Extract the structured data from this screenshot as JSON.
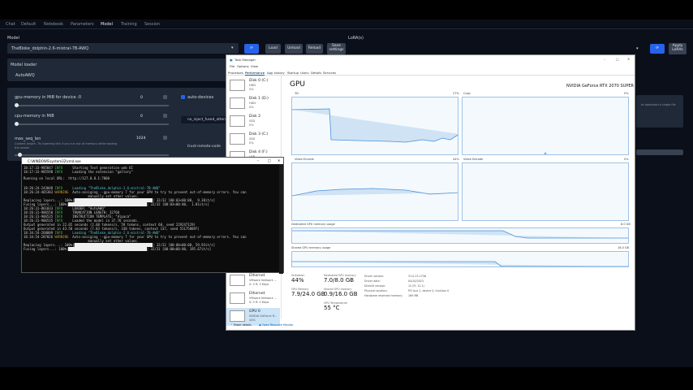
{
  "webui": {
    "tabs": [
      "Chat",
      "Default",
      "Notebook",
      "Parameters",
      "Model",
      "Training",
      "Session"
    ],
    "active_tab": "Model",
    "model_label": "Model",
    "model_value": "TheBloke_dolphin-2.6-mistral-7B-AWQ",
    "buttons": {
      "load": "Load",
      "unload": "Unload",
      "reload": "Reload",
      "save": "Save settings",
      "apply_lora": "Apply LoRAs"
    },
    "lora_label": "LoRA(s)",
    "loader_label": "Model loader",
    "loader_value": "AutoAWQ",
    "gpu_mem_label": "gpu-memory in MiB for device :0",
    "gpu_mem_value": "0",
    "cpu_mem_label": "cpu-memory in MiB",
    "cpu_mem_value": "0",
    "max_seq_label": "max_seq_len",
    "max_seq_value": "1024",
    "max_seq_help": "Context length. Try lowering this if you run out of memory while loading the model.",
    "auto_devices": "auto-devices",
    "no_inject": "no_inject_fused_atten",
    "trust_remote": "trust-remote-code",
    "right_hint": "to download a single file"
  },
  "taskmanager": {
    "title": "Task Manager",
    "menu": [
      "File",
      "Options",
      "View"
    ],
    "tabs": [
      "Processes",
      "Performance",
      "App history",
      "Startup",
      "Users",
      "Details",
      "Services"
    ],
    "active_tab": "Performance",
    "side_items": [
      {
        "name": "Disk 0 (C:)",
        "l1": "HDD",
        "l2": "0%"
      },
      {
        "name": "Disk 1 (D:)",
        "l1": "HDD",
        "l2": "0%"
      },
      {
        "name": "Disk 2",
        "l1": "SSD",
        "l2": "0%"
      },
      {
        "name": "Disk 3 (C:)",
        "l1": "SSD",
        "l2": "0%"
      },
      {
        "name": "Disk 4 (F:)",
        "l1": "USB",
        "l2": "0%"
      },
      {
        "name": "Ethernet",
        "l1": "VMware Network ...",
        "l2": "S: 0 R: 0 Kbps"
      },
      {
        "name": "Ethernet",
        "l1": "VMware Network ...",
        "l2": "S: 0 R: 0 Kbps"
      },
      {
        "name": "GPU 0",
        "l1": "NVIDIA GeForce R...",
        "l2": "44%"
      }
    ],
    "gpu_title": "GPU",
    "gpu_model": "NVIDIA GeForce RTX 2070 SUPER",
    "graphs": {
      "g1": "3D",
      "g2": "Copy",
      "g3": "Video Encode",
      "g4": "Video Decode",
      "pct1": "27%",
      "pct2": "0%",
      "pct3": "44%",
      "pct4": "0%"
    },
    "dedicated_label": "Dedicated GPU memory usage",
    "dedicated_max": "8.0 GB",
    "shared_label": "Shared GPU memory usage",
    "shared_max": "16.0 GB",
    "stats": {
      "util_k": "Utilization",
      "util_v": "44%",
      "ded_k": "Dedicated GPU memory",
      "ded_v": "7.0/8.0 GB",
      "gpum_k": "GPU Memory",
      "gpum_v": "7.9/24.0 GB",
      "sh_k": "Shared GPU memory",
      "sh_v": "0.9/16.0 GB",
      "temp_k": "GPU Temperature",
      "temp_v": "55 °C"
    },
    "details": [
      [
        "Driver version:",
        "31.0.15.2756"
      ],
      [
        "Driver date:",
        "04/10/2023"
      ],
      [
        "DirectX version:",
        "12 (FL 12.1)"
      ],
      [
        "Physical location:",
        "PCI bus 1, device 0, function 0"
      ],
      [
        "Hardware reserved memory:",
        "169 MB"
      ]
    ],
    "fewer_details": "Fewer details",
    "resource_monitor": "Open Resource Monitor"
  },
  "cmd": {
    "title": "C:\\WINDOWS\\system32\\cmd.exe",
    "lines": [
      {
        "t": "18:17:33-985847",
        "l": "INFO",
        "m": "Starting Text generation web UI"
      },
      {
        "t": "18:17:33-985598",
        "l": "INFO",
        "m": "Loading the extension \"gallery\""
      },
      {
        "t": "",
        "l": "",
        "m": "Running on local URL:  http://127.0.0.1:7860"
      },
      {
        "t": "18:26:24-243048",
        "l": "INFO",
        "m": "Loading \"TheBloke_dolphin-2.6-mistral-7B-AWQ\""
      },
      {
        "t": "18:26:24-465383",
        "l": "WARNING",
        "m": "Auto-assiging --gpu-memory 7 for your GPU to try to prevent out-of-memory errors. You can"
      },
      {
        "t": "",
        "l": "",
        "m": "                                 manually set other values."
      },
      {
        "t": "",
        "l": "",
        "m": "Replacing layers...: 100%|",
        "bar": true,
        "r": "| 32/32 [00:03<00:00,  9.38it/s]"
      },
      {
        "t": "",
        "l": "",
        "m": "Fusing layers...: 100%|",
        "bar": true,
        "r": "| 32/32 [00:03<00:00,  1.01it/s]"
      },
      {
        "t": "18:26:31-861033",
        "l": "INFO",
        "m": "LOADER: \"AutoAWQ\""
      },
      {
        "t": "18:26:31-906550",
        "l": "INFO",
        "m": "TRUNCATION LENGTH: 32768"
      },
      {
        "t": "18:26:31-906535",
        "l": "INFO",
        "m": "INSTRUCTION TEMPLATE: \"Alpaca\""
      },
      {
        "t": "18:26:31-906535",
        "l": "INFO",
        "m": "Loaded the model in 37.76 seconds."
      },
      {
        "t": "",
        "l": "",
        "m": "Output generated in 22.65 seconds (2.60 tokens/s, 59 tokens, context 60, seed 229247129)"
      },
      {
        "t": "",
        "l": "",
        "m": "Output generated in 43.58 seconds (7.83 tokens/s, 330 tokens, context 137, seed 551758097)"
      },
      {
        "t": "18:34:54-268089",
        "l": "INFO",
        "m": "Loading \"TheBloke_dolphin-2.6-mistral-7B-AWQ\""
      },
      {
        "t": "18:34:54-287026",
        "l": "WARNING",
        "m": "Auto-assiging --gpu-memory 7 for your GPU to try to prevent out-of-memory errors. You can"
      },
      {
        "t": "",
        "l": "",
        "m": "                                 manually set other values."
      },
      {
        "t": "",
        "l": "",
        "m": "Replacing layers...: 100%|",
        "bar": true,
        "r": "| 32/32 [00:00<00:00, 59.93it/s]"
      },
      {
        "t": "",
        "l": "",
        "m": "Fusing layers...: 100%|",
        "bar": true,
        "r": "| 32/31 [00:00<00:00, 195.67it/s]"
      }
    ]
  },
  "colors": {
    "accent": "#2563eb",
    "graph_line": "#4a90d9",
    "graph_fill": "#cfe3f5"
  }
}
